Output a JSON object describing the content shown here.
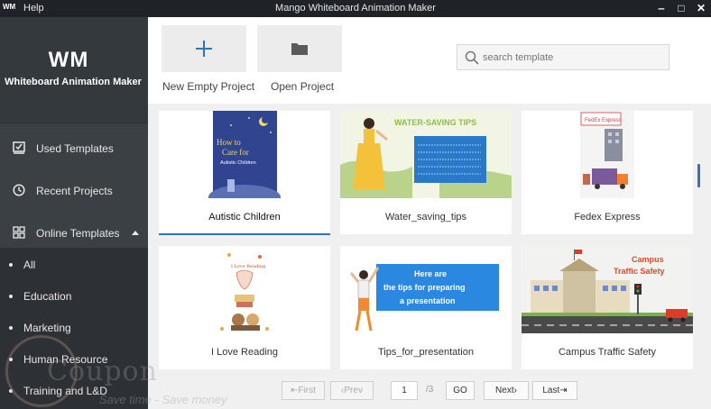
{
  "titlebar": {
    "app_logo": "WM",
    "menu_help": "Help",
    "title": "Mango Whiteboard Animation Maker",
    "min": "‒",
    "max": "□",
    "close": "✕"
  },
  "sidebar": {
    "logo": "WM",
    "brand": "Whiteboard Animation Maker",
    "nav": [
      {
        "label": "Used Templates",
        "icon": "template-check-icon"
      },
      {
        "label": "Recent Projects",
        "icon": "clock-icon"
      },
      {
        "label": "Online Templates",
        "icon": "grid-icon",
        "expanded": true
      }
    ],
    "sub": [
      "All",
      "Education",
      "Marketing",
      "Human Resource",
      "Training and L&D"
    ]
  },
  "toolbar": {
    "new_label": "New Empty Project",
    "open_label": "Open Project",
    "search_placeholder": "search template"
  },
  "templates": [
    {
      "name": "Autistic Children",
      "selected": true,
      "thumb_text": [
        "How to",
        "Care for",
        "Autistic Children"
      ]
    },
    {
      "name": "Water_saving_tips",
      "thumb_text": [
        "WATER-SAVING TIPS"
      ]
    },
    {
      "name": "Fedex Express",
      "thumb_text": [
        "FedEx Express"
      ]
    },
    {
      "name": "I Love Reading",
      "thumb_text": [
        "I Love Reading"
      ]
    },
    {
      "name": "Tips_for_presentation",
      "thumb_text": [
        "Here are",
        "the tips for preparing",
        "a presentation"
      ]
    },
    {
      "name": "Campus Traffic Safety",
      "thumb_text": [
        "Campus",
        "Traffic Safety"
      ]
    }
  ],
  "pagination": {
    "first": "⇤First",
    "prev": "‹Prev",
    "page": "1",
    "total": "/3",
    "go": "GO",
    "next": "Next›",
    "last": "Last⇥"
  },
  "watermark": {
    "coupon": "Coupon",
    "tagline": "Save time - Save money"
  },
  "colors": {
    "accent": "#2f74c0",
    "sidebar": "#3b4045",
    "titlebar": "#1f2327"
  }
}
